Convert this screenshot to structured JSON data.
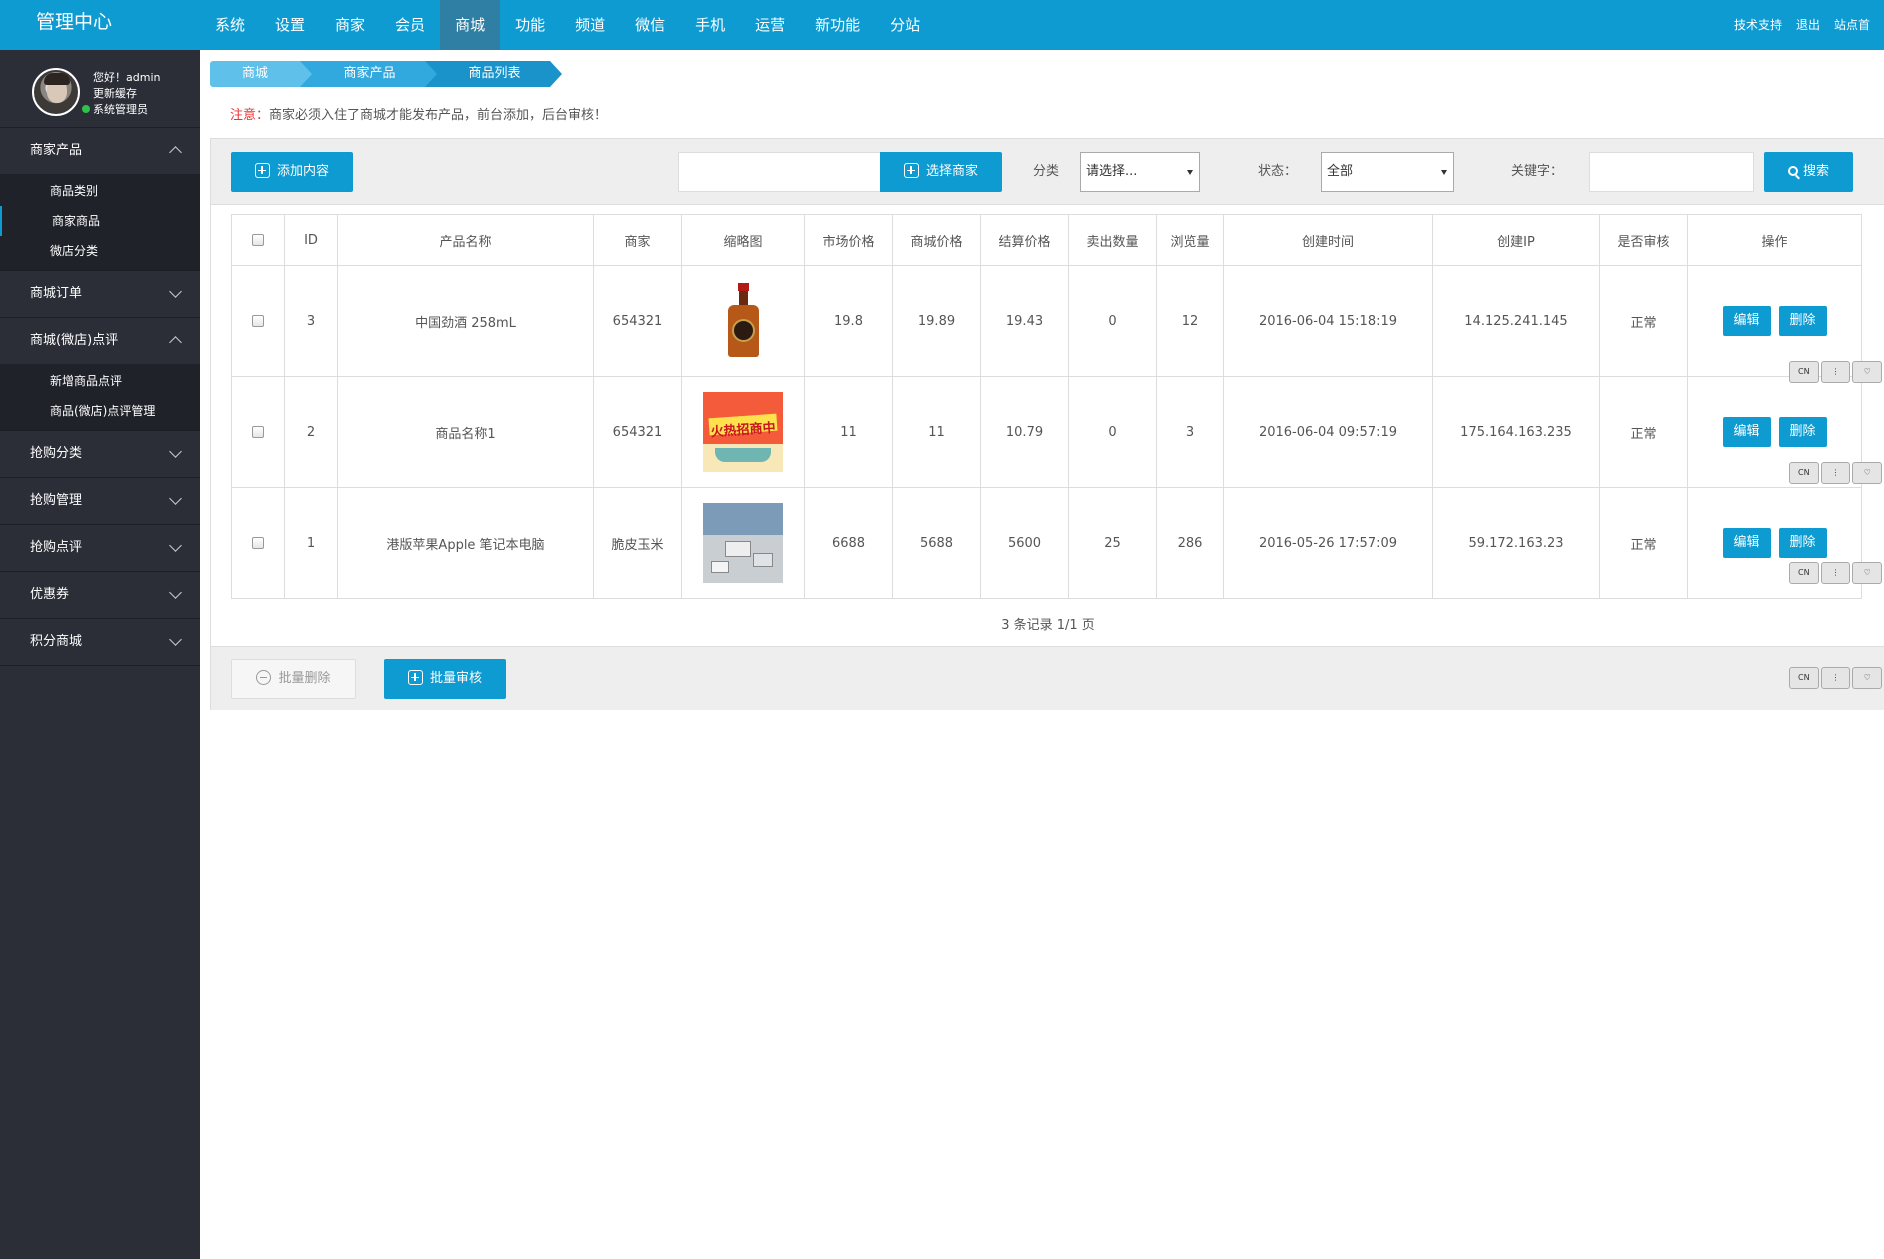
{
  "topbar": {
    "brand": "管理中心",
    "nav": [
      "系统",
      "设置",
      "商家",
      "会员",
      "商城",
      "功能",
      "频道",
      "微信",
      "手机",
      "运营",
      "新功能",
      "分站"
    ],
    "active_nav": "商城",
    "links": [
      "技术支持",
      "退出",
      "站点首"
    ]
  },
  "user": {
    "greeting": "您好！admin",
    "refresh": "更新缓存",
    "role": "系统管理员"
  },
  "sidebar": {
    "groups": [
      {
        "label": "商家产品",
        "expanded": true,
        "items": [
          "商品类别",
          "商家商品",
          "微店分类"
        ]
      },
      {
        "label": "商城订单",
        "expanded": false,
        "items": []
      },
      {
        "label": "商城(微店)点评",
        "expanded": true,
        "items": [
          "新增商品点评",
          "商品(微店)点评管理"
        ]
      },
      {
        "label": "抢购分类",
        "expanded": false,
        "items": []
      },
      {
        "label": "抢购管理",
        "expanded": false,
        "items": []
      },
      {
        "label": "抢购点评",
        "expanded": false,
        "items": []
      },
      {
        "label": "优惠券",
        "expanded": false,
        "items": []
      },
      {
        "label": "积分商城",
        "expanded": false,
        "items": []
      }
    ],
    "active_item": "商家商品"
  },
  "breadcrumb": [
    "商城",
    "商家产品",
    "商品列表"
  ],
  "notice": {
    "label": "注意：",
    "text": "商家必须入住了商城才能发布产品，前台添加，后台审核！"
  },
  "toolbar": {
    "add_label": "添加内容",
    "merchant_value": "",
    "select_merchant_label": "选择商家",
    "category_label": "分类",
    "category_value": "请选择...",
    "status_label": "状态：",
    "status_value": "全部",
    "keyword_label": "关键字：",
    "keyword_value": "",
    "search_label": "搜索"
  },
  "table": {
    "headers": [
      "",
      "ID",
      "产品名称",
      "商家",
      "缩略图",
      "市场价格",
      "商城价格",
      "结算价格",
      "卖出数量",
      "浏览量",
      "创建时间",
      "创建IP",
      "是否审核",
      "操作"
    ],
    "rows": [
      {
        "id": "3",
        "name": "中国劲酒 258mL",
        "merchant": "654321",
        "thumb": "liquor-bottle",
        "market_price": "19.8",
        "mall_price": "19.89",
        "settle_price": "19.43",
        "sold": "0",
        "views": "12",
        "created": "2016-06-04 15:18:19",
        "ip": "14.125.241.145",
        "status": "正常"
      },
      {
        "id": "2",
        "name": "商品名称1",
        "merchant": "654321",
        "thumb": "promo-banner",
        "thumb_text": "火热招商中",
        "market_price": "11",
        "mall_price": "11",
        "settle_price": "10.79",
        "sold": "0",
        "views": "3",
        "created": "2016-06-04 09:57:19",
        "ip": "175.164.163.235",
        "status": "正常"
      },
      {
        "id": "1",
        "name": "港版苹果Apple 笔记本电脑",
        "merchant": "脆皮玉米",
        "thumb": "laptop-photo",
        "market_price": "6688",
        "mall_price": "5688",
        "settle_price": "5600",
        "sold": "25",
        "views": "286",
        "created": "2016-05-26 17:57:09",
        "ip": "59.172.163.23",
        "status": "正常"
      }
    ],
    "edit_label": "编辑",
    "delete_label": "删除"
  },
  "pager": "3 条记录 1/1 页",
  "bottom": {
    "batch_delete_label": "批量删除",
    "batch_approve_label": "批量审核"
  },
  "widget": {
    "lang": "CN",
    "more": "⋮",
    "fav": "♡"
  },
  "colors": {
    "primary": "#0d9bd2",
    "sidebar": "#2b2e37",
    "notice_red": "#e33333"
  }
}
